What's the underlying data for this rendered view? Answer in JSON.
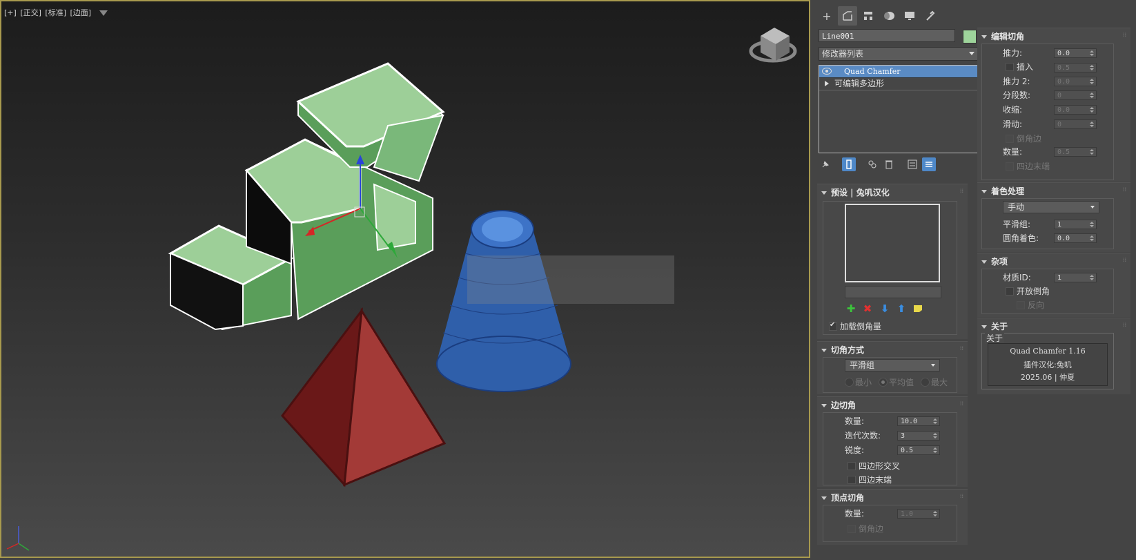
{
  "viewport": {
    "labels": [
      "[+]",
      "[正交]",
      "[标准]",
      "[边面]"
    ]
  },
  "command_panel": {
    "tabs": [
      "create",
      "modify",
      "hierarchy",
      "motion",
      "display",
      "utilities"
    ],
    "object_name": "Line001",
    "object_color": "#9ed49b",
    "modifier_list": "修改器列表",
    "stack": {
      "selected": "Quad Chamfer",
      "child": "可编辑多边形"
    }
  },
  "presets": {
    "title": "预设 | 兔叽汉化",
    "load_chamfer": "加载倒角量"
  },
  "chamfer_type": {
    "title": "切角方式",
    "dropdown": "平滑组",
    "radio_min": "最小",
    "radio_avg": "平均值",
    "radio_max": "最大"
  },
  "edge_chamfer": {
    "title": "边切角",
    "amount_label": "数量:",
    "amount": "10.0",
    "iterations_label": "迭代次数:",
    "iterations": "3",
    "sharpness_label": "锐度:",
    "sharpness": "0.5",
    "quad_intersect": "四边形交叉",
    "quad_end": "四边末端"
  },
  "vertex_chamfer": {
    "title": "顶点切角",
    "amount_label": "数量:",
    "amount": "1.0",
    "chamfer_edge": "倒角边"
  },
  "edit_chamfer": {
    "title": "编辑切角",
    "push_label": "推力:",
    "push": "0.0",
    "insert": "插入",
    "insert_val": "0.5",
    "push2_label": "推力 2:",
    "push2": "0.0",
    "segments_label": "分段数:",
    "segments": "0",
    "shrink_label": "收缩:",
    "shrink": "0.0",
    "slide_label": "滑动:",
    "slide": "0",
    "chamfer_edge": "倒角边",
    "amount_label": "数量:",
    "amount": "0.5",
    "quad_end": "四边末端"
  },
  "shading": {
    "title": "着色处理",
    "mode": "手动",
    "smooth_label": "平滑组:",
    "smooth": "1",
    "round_label": "圆角着色:",
    "round": "0.0"
  },
  "misc": {
    "title": "杂项",
    "matid_label": "材质ID:",
    "matid": "1",
    "open_chamfer": "开放倒角",
    "reverse": "反向"
  },
  "about": {
    "title": "关于",
    "group": "关于",
    "line1": "Quad Chamfer 1.16",
    "line2": "插件汉化:兔叽",
    "line3": "2025.06 | 仲夏"
  }
}
